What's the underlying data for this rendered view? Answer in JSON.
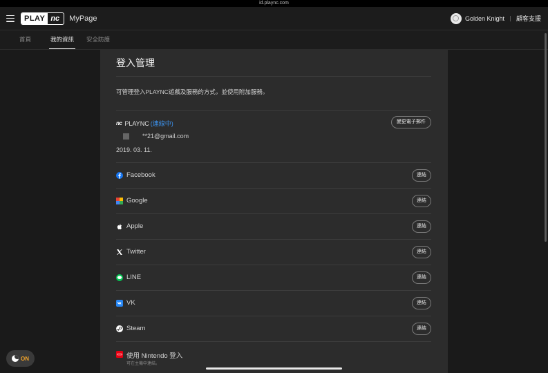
{
  "browser": {
    "url": "id.plaync.com"
  },
  "header": {
    "logo_play": "PLAY",
    "logo_nc": "nc",
    "mypage": "MyPage",
    "username": "Golden Knight",
    "support": "顧客支援"
  },
  "tabs": [
    {
      "label": "首頁",
      "active": false
    },
    {
      "label": "我的資訊",
      "active": true
    },
    {
      "label": "安全防護",
      "active": false
    }
  ],
  "panel": {
    "title": "登入管理",
    "description": "可管理登入PLAYNC遊戲及服務的方式，並使用附加服務。",
    "plaync": {
      "mark": "nc",
      "name": "PLAYNC",
      "status": "(連線中)",
      "email": "**21@gmail.com",
      "date": "2019. 03. 11.",
      "change_email": "變更電子郵件"
    },
    "services": [
      {
        "name": "Facebook",
        "icon": "facebook-icon",
        "button": "連結",
        "color": "#1877f2"
      },
      {
        "name": "Google",
        "icon": "google-icon",
        "button": "連結",
        "color": "#ea4335"
      },
      {
        "name": "Apple",
        "icon": "apple-icon",
        "button": "連結",
        "color": "#ffffff"
      },
      {
        "name": "Twitter",
        "icon": "x-icon",
        "button": "連結",
        "color": "#ffffff"
      },
      {
        "name": "LINE",
        "icon": "line-icon",
        "button": "連結",
        "color": "#06c755"
      },
      {
        "name": "VK",
        "icon": "vk-icon",
        "button": "連結",
        "color": "#2787f5"
      },
      {
        "name": "Steam",
        "icon": "steam-icon",
        "button": "連結",
        "color": "#ffffff"
      }
    ],
    "nintendo": {
      "name": "使用 Nintendo 登入",
      "sub": "可在主機中連結。",
      "icon": "nintendo-icon",
      "color": "#e60012"
    }
  },
  "theme_toggle": {
    "label": "ON",
    "icon": "moon-icon"
  }
}
